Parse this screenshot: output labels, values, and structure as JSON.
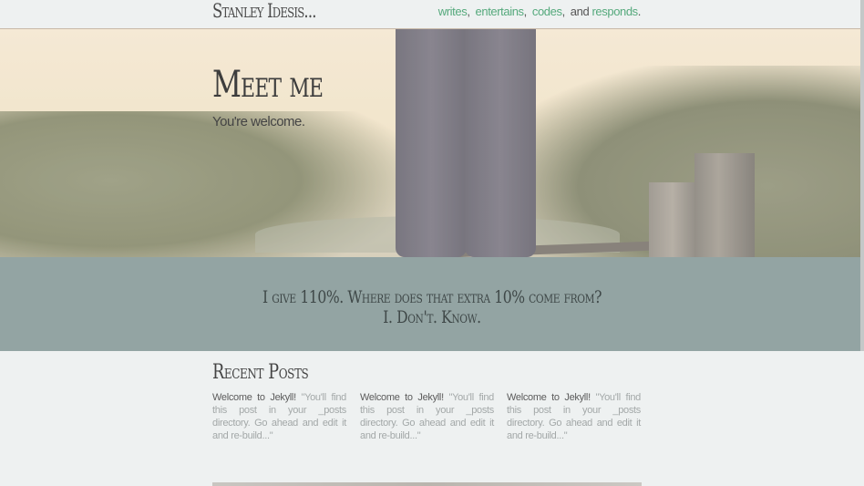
{
  "header": {
    "brand": "Stanley Idesis...",
    "nav": [
      {
        "label": "writes"
      },
      {
        "label": "entertains"
      },
      {
        "label": "codes"
      }
    ],
    "nav_and": "and",
    "nav_last": "responds"
  },
  "hero": {
    "title": "Meet me",
    "subtitle": "You're welcome."
  },
  "quote": {
    "line1": "I give 110%. Where does that extra 10% come from?",
    "line2": "I. Don't. Know."
  },
  "recent": {
    "title": "Recent Posts",
    "posts": [
      {
        "title": "Welcome to Jekyll!",
        "excerpt": "\"You'll find this post in your _posts directory. Go ahead and edit it and re-build...\""
      },
      {
        "title": "Welcome to Jekyll!",
        "excerpt": "\"You'll find this post in your _posts directory. Go ahead and edit it and re-build...\""
      },
      {
        "title": "Welcome to Jekyll!",
        "excerpt": "\"You'll find this post in your _posts directory. Go ahead and edit it and re-build...\""
      }
    ]
  },
  "colors": {
    "link": "#55a97c",
    "quote_band": "#93a4a3",
    "background": "#eef1f1"
  }
}
